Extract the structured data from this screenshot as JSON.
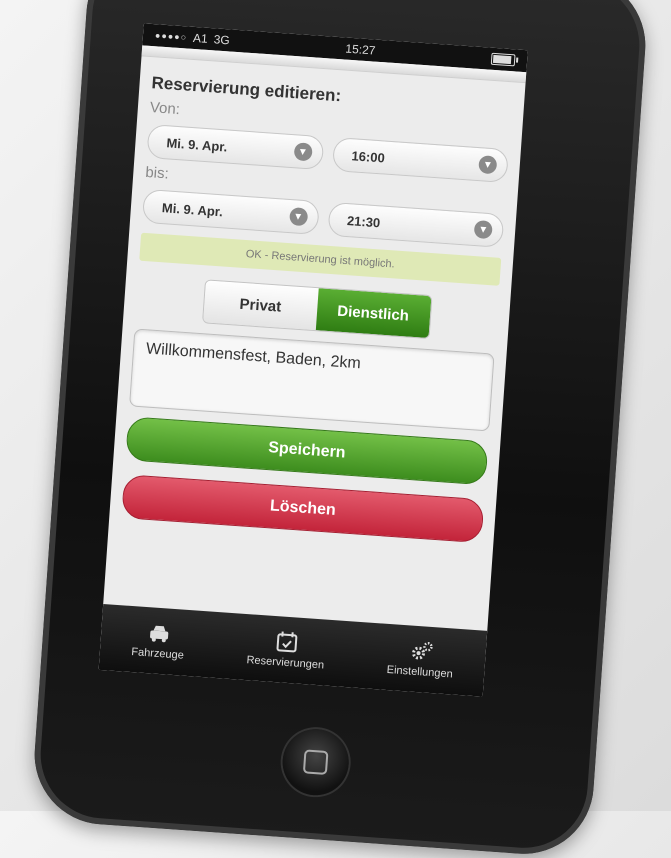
{
  "statusbar": {
    "carrier": "A1",
    "network": "3G",
    "time": "15:27"
  },
  "page": {
    "title": "Reservierung editieren:"
  },
  "from": {
    "label": "Von:",
    "date": "Mi. 9. Apr.",
    "time": "16:00"
  },
  "to": {
    "label": "bis:",
    "date": "Mi. 9. Apr.",
    "time": "21:30"
  },
  "status_message": "OK - Reservierung ist möglich.",
  "segment": {
    "options": [
      "Privat",
      "Dienstlich"
    ],
    "selected": "Dienstlich"
  },
  "note": {
    "value": "Willkommensfest, Baden, 2km"
  },
  "buttons": {
    "save": "Speichern",
    "delete": "Löschen"
  },
  "tabbar": {
    "items": [
      {
        "label": "Fahrzeuge",
        "icon": "car-icon"
      },
      {
        "label": "Reservierungen",
        "icon": "calendar-check-icon"
      },
      {
        "label": "Einstellungen",
        "icon": "gears-icon"
      }
    ]
  },
  "colors": {
    "accent_green": "#3d8d1e",
    "danger_red": "#c3243a",
    "ok_background": "#dfe9b6"
  }
}
